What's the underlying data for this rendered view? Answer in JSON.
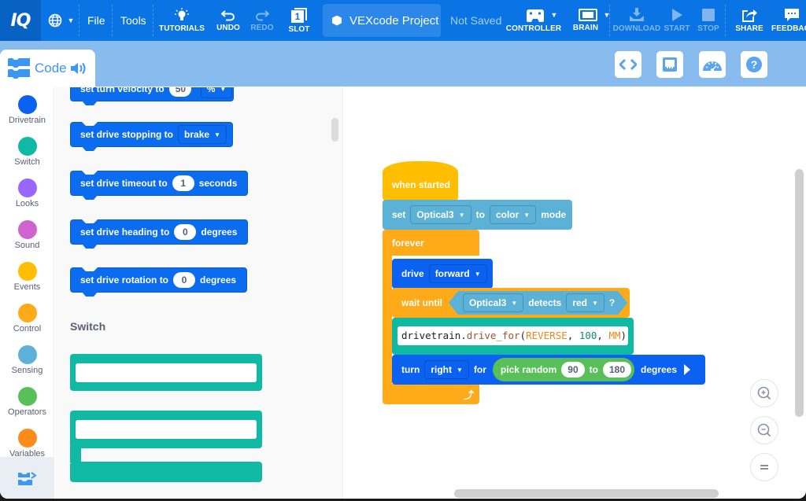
{
  "topbar": {
    "logo": "IQ",
    "menus": [
      "File",
      "Tools"
    ],
    "tutorials": "TUTORIALS",
    "undo": "UNDO",
    "redo": "REDO",
    "slot": "SLOT",
    "slot_number": "1",
    "project_name": "VEXcode Project",
    "save_status": "Not Saved",
    "controller": "CONTROLLER",
    "brain": "BRAIN",
    "download": "DOWNLOAD",
    "start": "START",
    "stop": "STOP",
    "share": "SHARE",
    "feedback": "FEEDBACK"
  },
  "code_tab": {
    "label": "Code"
  },
  "categories": [
    {
      "label": "Drivetrain",
      "color": "#0b62f0"
    },
    {
      "label": "Switch",
      "color": "#10b9a3"
    },
    {
      "label": "Looks",
      "color": "#9966ff"
    },
    {
      "label": "Sound",
      "color": "#cf63cf"
    },
    {
      "label": "Events",
      "color": "#ffbf00"
    },
    {
      "label": "Control",
      "color": "#ffab19"
    },
    {
      "label": "Sensing",
      "color": "#5cb1d6"
    },
    {
      "label": "Operators",
      "color": "#59c059"
    },
    {
      "label": "Variables",
      "color": "#ff8c1a"
    }
  ],
  "palette": {
    "blocks": [
      {
        "pre": "set turn velocity to",
        "value": "50",
        "dropdown": "%"
      },
      {
        "pre": "set drive stopping to",
        "dropdown": "brake"
      },
      {
        "pre": "set drive timeout to",
        "value": "1",
        "post": "seconds"
      },
      {
        "pre": "set drive heading to",
        "value": "0",
        "post": "degrees"
      },
      {
        "pre": "set drive rotation to",
        "value": "0",
        "post": "degrees"
      }
    ],
    "switch_heading": "Switch"
  },
  "script": {
    "hat": "when started",
    "set_block": {
      "pre": "set",
      "sensor": "Optical3",
      "to": "to",
      "mode": "color",
      "post": "mode"
    },
    "forever": "forever",
    "drive": {
      "label": "drive",
      "direction": "forward"
    },
    "wait": {
      "label": "wait until",
      "sensor": "Optical3",
      "detects": "detects",
      "color": "red",
      "q": "?"
    },
    "python": {
      "obj": "drivetrain.",
      "fn": "drive_for",
      "open": "(",
      "a1": "REVERSE",
      "c1": ", ",
      "a2": "100",
      "c2": ", ",
      "a3": "MM",
      "close": ")"
    },
    "turn": {
      "label": "turn",
      "direction": "right",
      "for": "for",
      "random": "pick random",
      "from": "90",
      "to": "to",
      "max": "180",
      "unit": "degrees"
    }
  }
}
